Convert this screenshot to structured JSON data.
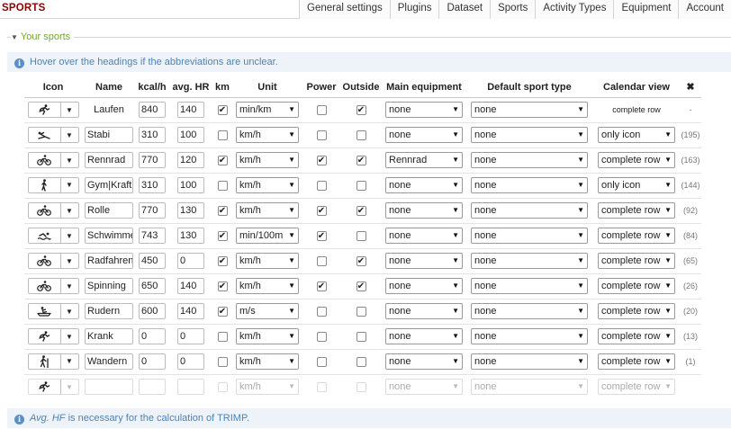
{
  "app": {
    "title": "SPORTS"
  },
  "nav": {
    "tabs": [
      "General settings",
      "Plugins",
      "Dataset",
      "Sports",
      "Activity Types",
      "Equipment",
      "Account"
    ]
  },
  "section": {
    "title": "Your sports"
  },
  "info_top": "Hover over the headings if the abbreviations are unclear.",
  "info_bottom": {
    "term": "Avg. HF",
    "text": " is necessary for the calculation of TRIMP."
  },
  "table": {
    "headers": {
      "icon": "Icon",
      "name": "Name",
      "kcal": "kcal/h",
      "hr": "avg. HR",
      "km": "km",
      "unit": "Unit",
      "power": "Power",
      "outside": "Outside",
      "equipment": "Main equipment",
      "default_type": "Default sport type",
      "calendar": "Calendar view",
      "delete": "✖"
    },
    "rows": [
      {
        "icon": "running-icon",
        "name": "Laufen",
        "kcal": "840",
        "hr": "140",
        "km": "✔",
        "unit": "min/km",
        "power": "",
        "outside": "✔",
        "equipment": "none",
        "default_type": "none",
        "calendar": "complete row",
        "count": "-"
      },
      {
        "icon": "stretching-icon",
        "name": "Stabi",
        "kcal": "310",
        "hr": "100",
        "km": "",
        "unit": "km/h",
        "power": "",
        "outside": "",
        "equipment": "none",
        "default_type": "none",
        "calendar": "only icon",
        "count": "(195)"
      },
      {
        "icon": "bike-icon",
        "name": "Rennrad",
        "kcal": "770",
        "hr": "120",
        "km": "✔",
        "unit": "km/h",
        "power": "✔",
        "outside": "✔",
        "equipment": "Rennrad",
        "default_type": "none",
        "calendar": "complete row",
        "count": "(163)"
      },
      {
        "icon": "gym-icon",
        "name": "Gym|Kraft|",
        "kcal": "310",
        "hr": "100",
        "km": "",
        "unit": "km/h",
        "power": "",
        "outside": "",
        "equipment": "none",
        "default_type": "none",
        "calendar": "only icon",
        "count": "(144)"
      },
      {
        "icon": "bike-icon",
        "name": "Rolle",
        "kcal": "770",
        "hr": "130",
        "km": "✔",
        "unit": "km/h",
        "power": "✔",
        "outside": "✔",
        "equipment": "none",
        "default_type": "none",
        "calendar": "complete row",
        "count": "(92)"
      },
      {
        "icon": "swimming-icon",
        "name": "Schwimme",
        "kcal": "743",
        "hr": "130",
        "km": "✔",
        "unit": "min/100m",
        "power": "✔",
        "outside": "",
        "equipment": "none",
        "default_type": "none",
        "calendar": "complete row",
        "count": "(84)"
      },
      {
        "icon": "bike-icon",
        "name": "Radfahren",
        "kcal": "450",
        "hr": "0",
        "km": "✔",
        "unit": "km/h",
        "power": "",
        "outside": "✔",
        "equipment": "none",
        "default_type": "none",
        "calendar": "complete row",
        "count": "(65)"
      },
      {
        "icon": "bike-icon",
        "name": "Spinning",
        "kcal": "650",
        "hr": "140",
        "km": "✔",
        "unit": "km/h",
        "power": "✔",
        "outside": "✔",
        "equipment": "none",
        "default_type": "none",
        "calendar": "complete row",
        "count": "(26)"
      },
      {
        "icon": "rowing-icon",
        "name": "Rudern",
        "kcal": "600",
        "hr": "140",
        "km": "✔",
        "unit": "m/s",
        "power": "",
        "outside": "",
        "equipment": "none",
        "default_type": "none",
        "calendar": "complete row",
        "count": "(20)"
      },
      {
        "icon": "running-icon",
        "name": "Krank",
        "kcal": "0",
        "hr": "0",
        "km": "",
        "unit": "km/h",
        "power": "",
        "outside": "",
        "equipment": "none",
        "default_type": "none",
        "calendar": "complete row",
        "count": "(13)"
      },
      {
        "icon": "hiking-icon",
        "name": "Wandern",
        "kcal": "0",
        "hr": "0",
        "km": "",
        "unit": "km/h",
        "power": "",
        "outside": "",
        "equipment": "none",
        "default_type": "none",
        "calendar": "complete row",
        "count": "(1)"
      },
      {
        "icon": "running-icon",
        "name": "",
        "kcal": "",
        "hr": "",
        "km": "",
        "unit": "km/h",
        "power": "",
        "outside": "",
        "equipment": "none",
        "default_type": "none",
        "calendar": "complete row",
        "count": ""
      }
    ]
  }
}
